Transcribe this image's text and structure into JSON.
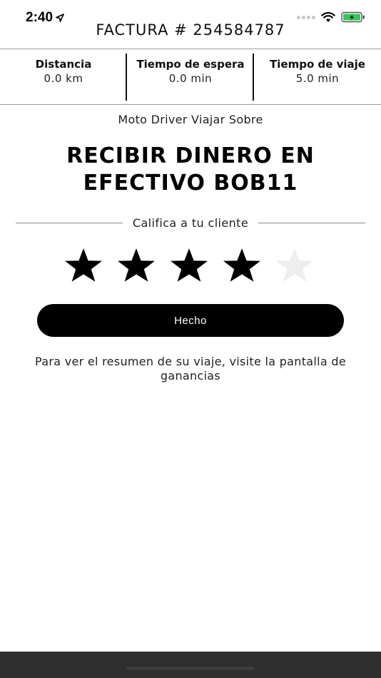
{
  "status_bar": {
    "time": "2:40",
    "icons": [
      "location-arrow-icon",
      "signal-dots-icon",
      "wifi-icon",
      "battery-charging-icon"
    ]
  },
  "header": {
    "title": "FACTURA # 254584787"
  },
  "stats": [
    {
      "label": "Distancia",
      "value": "0.0 km"
    },
    {
      "label": "Tiempo de espera",
      "value": "0.0 min"
    },
    {
      "label": "Tiempo de viaje",
      "value": "5.0 min"
    }
  ],
  "ride": {
    "service_label": "Moto Driver Viajar Sobre",
    "headline": "RECIBIR DINERO EN EFECTIVO BOB11"
  },
  "rating": {
    "label": "Califica a tu cliente",
    "stars_selected": 4,
    "stars_total": 5,
    "colors": {
      "filled": "#000000",
      "empty": "#eeeeee"
    }
  },
  "done_button": {
    "label": "Hecho"
  },
  "info": {
    "text": "Para ver el resumen de su viaje, visite la pantalla de ganancias"
  },
  "colors": {
    "accent": "#000000",
    "battery": "#34c759"
  }
}
